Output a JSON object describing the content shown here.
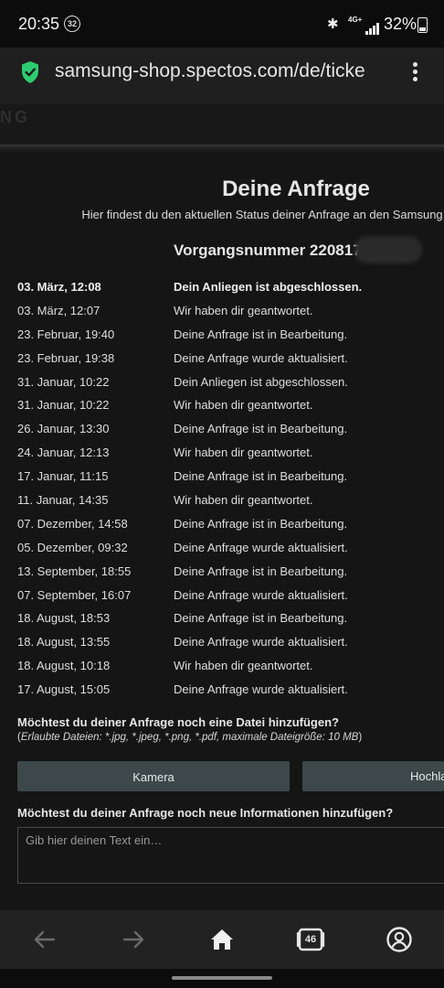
{
  "status_bar": {
    "time": "20:35",
    "notification_badge": "32",
    "network": "4G+",
    "battery": "32%"
  },
  "browser": {
    "url": "samsung-shop.spectos.com/de/ticke",
    "tab_count": "46"
  },
  "site": {
    "logo_fragment": "NG"
  },
  "page": {
    "title": "Deine Anfrage",
    "subtitle": "Hier findest du den aktuellen Status deiner Anfrage an den Samsung",
    "case_number": "Vorgangsnummer 220817.0"
  },
  "history": [
    {
      "date": "03. März, 12:08",
      "status": "Dein Anliegen ist abgeschlossen."
    },
    {
      "date": "03. März, 12:07",
      "status": "Wir haben dir geantwortet."
    },
    {
      "date": "23. Februar, 19:40",
      "status": "Deine Anfrage ist in Bearbeitung."
    },
    {
      "date": "23. Februar, 19:38",
      "status": "Deine Anfrage wurde aktualisiert."
    },
    {
      "date": "31. Januar, 10:22",
      "status": "Dein Anliegen ist abgeschlossen."
    },
    {
      "date": "31. Januar, 10:22",
      "status": "Wir haben dir geantwortet."
    },
    {
      "date": "26. Januar, 13:30",
      "status": "Deine Anfrage ist in Bearbeitung."
    },
    {
      "date": "24. Januar, 12:13",
      "status": "Wir haben dir geantwortet."
    },
    {
      "date": "17. Januar, 11:15",
      "status": "Deine Anfrage ist in Bearbeitung."
    },
    {
      "date": "11. Januar, 14:35",
      "status": "Wir haben dir geantwortet."
    },
    {
      "date": "07. Dezember, 14:58",
      "status": "Deine Anfrage ist in Bearbeitung."
    },
    {
      "date": "05. Dezember, 09:32",
      "status": "Deine Anfrage wurde aktualisiert."
    },
    {
      "date": "13. September, 18:55",
      "status": "Deine Anfrage ist in Bearbeitung."
    },
    {
      "date": "07. September, 16:07",
      "status": "Deine Anfrage wurde aktualisiert."
    },
    {
      "date": "18. August, 18:53",
      "status": "Deine Anfrage ist in Bearbeitung."
    },
    {
      "date": "18. August, 13:55",
      "status": "Deine Anfrage wurde aktualisiert."
    },
    {
      "date": "18. August, 10:18",
      "status": "Wir haben dir geantwortet."
    },
    {
      "date": "17. August, 15:05",
      "status": "Deine Anfrage wurde aktualisiert."
    }
  ],
  "file_upload": {
    "question": "Möchtest du deiner Anfrage noch eine Datei hinzufügen?",
    "hint": "Erlaubte Dateien: *.jpg, *.jpeg, *.png, *.pdf, maximale Dateigröße: 10 MB",
    "camera_label": "Kamera",
    "upload_label": "Hochla"
  },
  "info": {
    "question": "Möchtest du deiner Anfrage noch neue Informationen hinzufügen?",
    "placeholder": "Gib hier deinen Text ein…"
  },
  "colors": {
    "background": "#151515",
    "button": "#3c4849",
    "secure_green": "#2ecc71"
  }
}
